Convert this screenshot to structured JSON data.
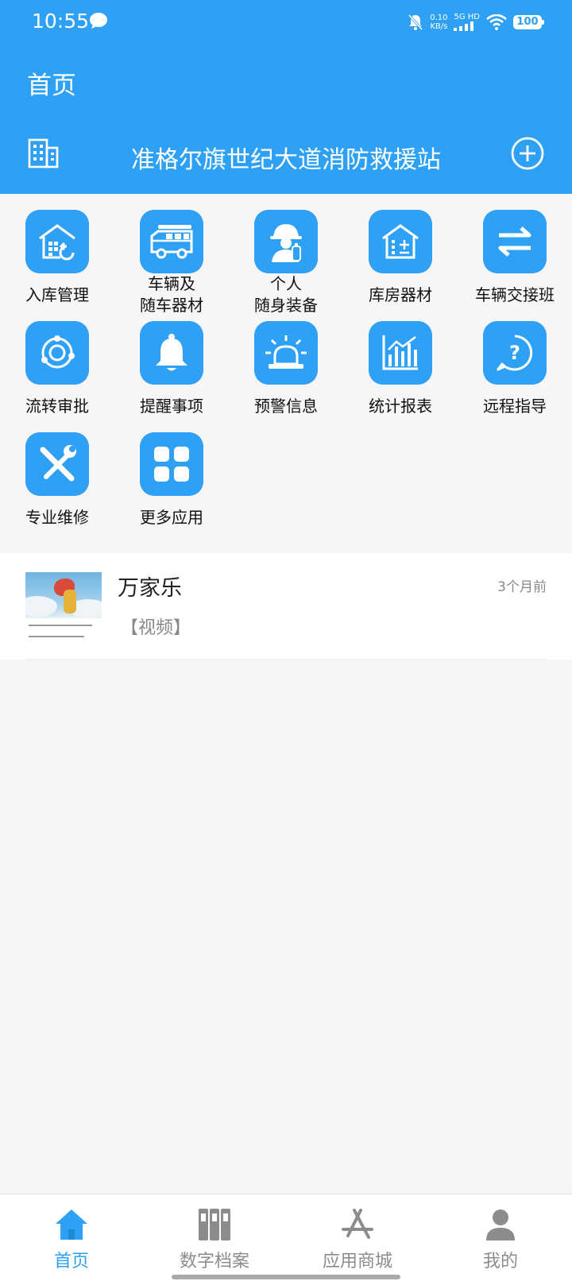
{
  "status_bar": {
    "time": "10:55",
    "net_speed_value": "0.10",
    "net_speed_unit": "KB/s",
    "network": "5G HD",
    "battery": "100"
  },
  "header": {
    "title": "首页",
    "station_name": "准格尔旗世纪大道消防救援站"
  },
  "apps": [
    {
      "label": "入库管理",
      "icon": "warehouse-in-icon"
    },
    {
      "label": "车辆及\n随车器材",
      "icon": "fire-truck-icon"
    },
    {
      "label": "个人\n随身装备",
      "icon": "firefighter-icon"
    },
    {
      "label": "库房器材",
      "icon": "storeroom-icon"
    },
    {
      "label": "车辆交接班",
      "icon": "swap-arrows-icon"
    },
    {
      "label": "流转审批",
      "icon": "circulation-icon"
    },
    {
      "label": "提醒事项",
      "icon": "bell-icon"
    },
    {
      "label": "预警信息",
      "icon": "alarm-light-icon"
    },
    {
      "label": "统计报表",
      "icon": "bar-chart-icon"
    },
    {
      "label": "远程指导",
      "icon": "help-bubble-icon"
    },
    {
      "label": "专业维修",
      "icon": "tools-icon"
    },
    {
      "label": "更多应用",
      "icon": "grid-apps-icon"
    }
  ],
  "news": [
    {
      "title": "万家乐",
      "tag": "【视频】",
      "time": "3个月前"
    }
  ],
  "tabs": [
    {
      "label": "首页",
      "icon": "home-icon",
      "active": true
    },
    {
      "label": "数字档案",
      "icon": "archive-icon",
      "active": false
    },
    {
      "label": "应用商城",
      "icon": "app-store-icon",
      "active": false
    },
    {
      "label": "我的",
      "icon": "user-icon",
      "active": false
    }
  ],
  "colors": {
    "accent": "#2fa1f5",
    "background": "#f6f6f7",
    "inactive_tab": "#8c8c8c"
  }
}
